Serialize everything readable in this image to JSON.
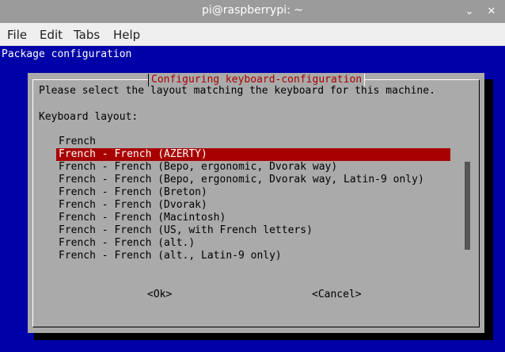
{
  "window": {
    "title": "pi@raspberrypi: ~",
    "minimize_glyph": "⌄",
    "close_glyph": "✕"
  },
  "menubar": {
    "items": [
      "File",
      "Edit",
      "Tabs",
      "Help"
    ]
  },
  "terminal": {
    "header": "Package configuration",
    "dialog": {
      "title": "Configuring keyboard-configuration",
      "prompt": "Please select the layout matching the keyboard for this machine.",
      "list_label": "Keyboard layout:",
      "options": [
        "French",
        "French - French (AZERTY)",
        "French - French (Bepo, ergonomic, Dvorak way)",
        "French - French (Bepo, ergonomic, Dvorak way, Latin-9 only)",
        "French - French (Breton)",
        "French - French (Dvorak)",
        "French - French (Macintosh)",
        "French - French (US, with French letters)",
        "French - French (alt.)",
        "French - French (alt., Latin-9 only)"
      ],
      "selected_index": 1,
      "ok_label": "<Ok>",
      "cancel_label": "<Cancel>"
    }
  },
  "colors": {
    "terminal_bg": "#0000a8",
    "dialog_bg": "#aaaaaa",
    "selection_bg": "#a80000",
    "title_color": "#a80000"
  }
}
